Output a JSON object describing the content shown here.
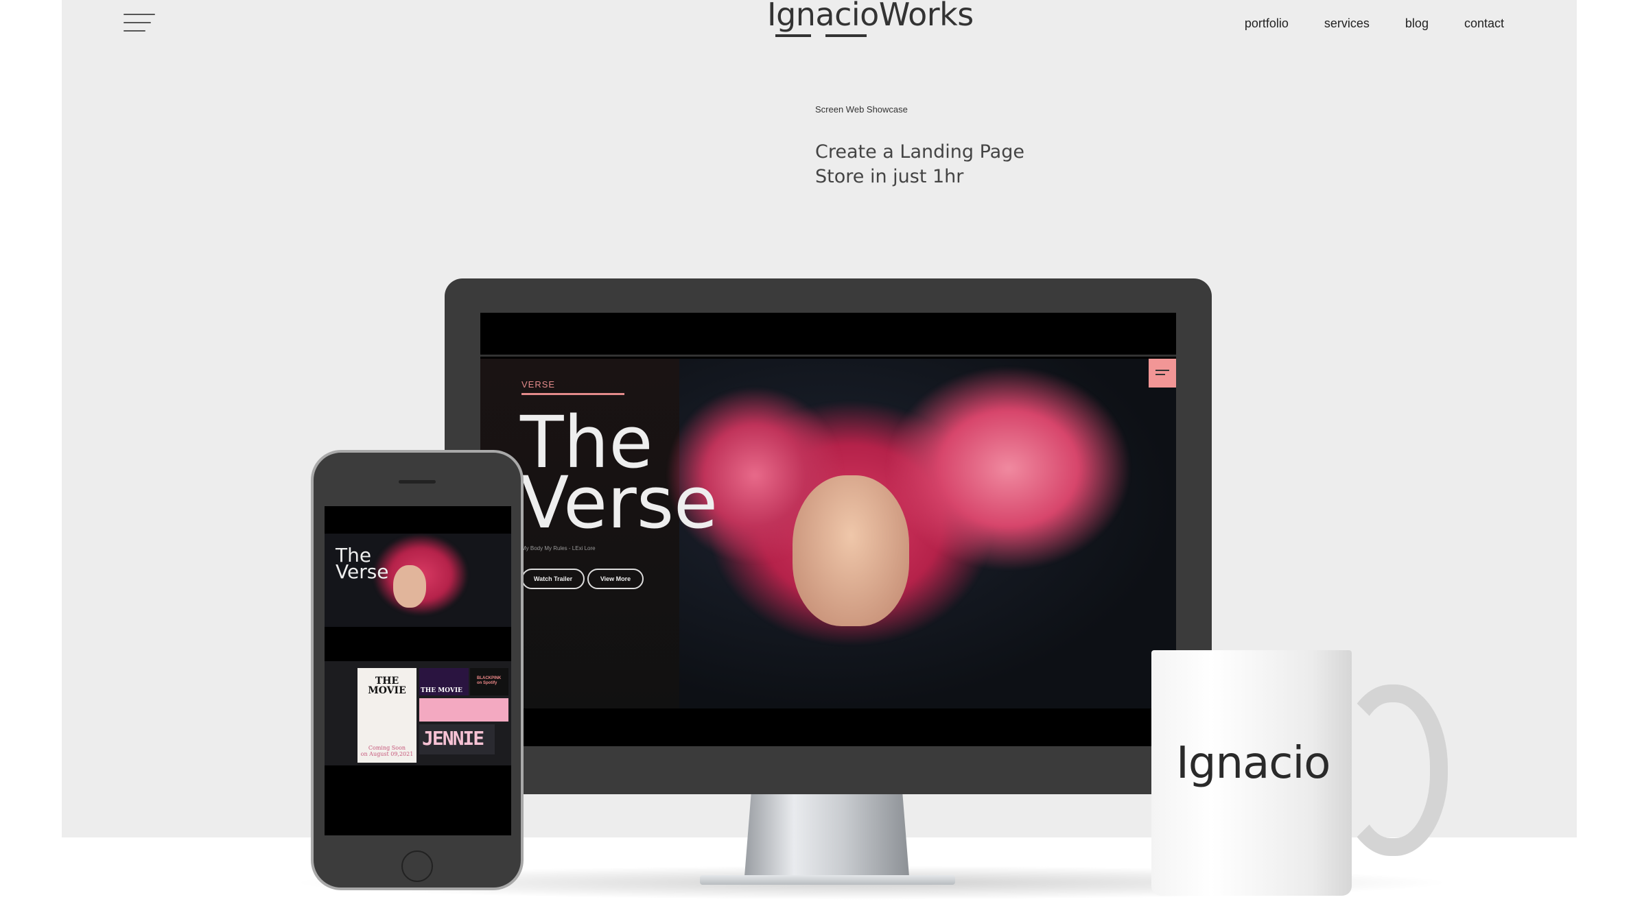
{
  "header": {
    "logo": "IgnacioWorks",
    "nav": [
      "portfolio",
      "services",
      "blog",
      "contact"
    ]
  },
  "hero": {
    "eyebrow": "Screen Web Showcase",
    "headline_line1": "Create a Landing Page",
    "headline_line2": "Store in just 1hr"
  },
  "monitor_site": {
    "tag": "VERSE",
    "title": "The\nVerse",
    "subtitle": "My Body My Rules - LExi Lore",
    "buttons": [
      "Watch Trailer",
      "View More"
    ]
  },
  "phone_site": {
    "title": "The\nVerse",
    "gallery": {
      "poster_title": "THE\nMOVIE",
      "poster_caption": "Coming Soon\non August 09,2021",
      "tile_caption": "THE MOVIE",
      "spotify": "BLACKPINK\non Spotify",
      "name_tile": "JENNIE"
    }
  },
  "mug": {
    "text": "Ignacio"
  },
  "colors": {
    "background": "#ededed",
    "accent_pink": "#f29696",
    "monitor_frame": "#3b3b3b"
  }
}
